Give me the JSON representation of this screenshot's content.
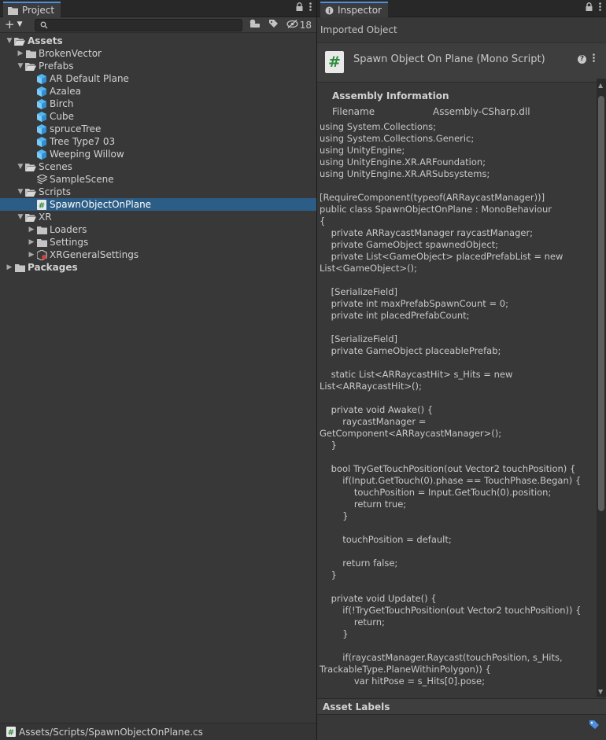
{
  "project": {
    "tab_label": "Project",
    "hidden_count": "18",
    "search_placeholder": "",
    "status_path": "Assets/Scripts/SpawnObjectOnPlane.cs",
    "tree": [
      {
        "label": "Assets",
        "depth": 0,
        "arrow": "down",
        "icon": "folder-open",
        "bold": true
      },
      {
        "label": "BrokenVector",
        "depth": 1,
        "arrow": "right",
        "icon": "folder"
      },
      {
        "label": "Prefabs",
        "depth": 1,
        "arrow": "down",
        "icon": "folder-open"
      },
      {
        "label": "AR Default Plane",
        "depth": 2,
        "arrow": "",
        "icon": "prefab"
      },
      {
        "label": "Azalea",
        "depth": 2,
        "arrow": "",
        "icon": "prefab"
      },
      {
        "label": "Birch",
        "depth": 2,
        "arrow": "",
        "icon": "prefab"
      },
      {
        "label": "Cube",
        "depth": 2,
        "arrow": "",
        "icon": "prefab"
      },
      {
        "label": "spruceTree",
        "depth": 2,
        "arrow": "",
        "icon": "prefab"
      },
      {
        "label": "Tree Type7 03",
        "depth": 2,
        "arrow": "",
        "icon": "prefab"
      },
      {
        "label": "Weeping Willow",
        "depth": 2,
        "arrow": "",
        "icon": "prefab"
      },
      {
        "label": "Scenes",
        "depth": 1,
        "arrow": "down",
        "icon": "folder-open"
      },
      {
        "label": "SampleScene",
        "depth": 2,
        "arrow": "",
        "icon": "scene"
      },
      {
        "label": "Scripts",
        "depth": 1,
        "arrow": "down",
        "icon": "folder-open"
      },
      {
        "label": "SpawnObjectOnPlane",
        "depth": 2,
        "arrow": "",
        "icon": "script",
        "selected": true
      },
      {
        "label": "XR",
        "depth": 1,
        "arrow": "down",
        "icon": "folder-open"
      },
      {
        "label": "Loaders",
        "depth": 2,
        "arrow": "right",
        "icon": "folder"
      },
      {
        "label": "Settings",
        "depth": 2,
        "arrow": "right",
        "icon": "folder"
      },
      {
        "label": "XRGeneralSettings",
        "depth": 2,
        "arrow": "right",
        "icon": "xr-settings"
      },
      {
        "label": "Packages",
        "depth": 0,
        "arrow": "right",
        "icon": "folder",
        "bold": true
      }
    ]
  },
  "inspector": {
    "tab_label": "Inspector",
    "header": "Imported Object",
    "asset_name": "Spawn Object On Plane (Mono Script)",
    "asset_icon_glyph": "#",
    "assembly_title": "Assembly Information",
    "filename_key": "Filename",
    "filename_value": "Assembly-CSharp.dll",
    "asset_labels": "Asset Labels",
    "code": "using System.Collections;\nusing System.Collections.Generic;\nusing UnityEngine;\nusing UnityEngine.XR.ARFoundation;\nusing UnityEngine.XR.ARSubsystems;\n\n[RequireComponent(typeof(ARRaycastManager))]\npublic class SpawnObjectOnPlane : MonoBehaviour\n{\n    private ARRaycastManager raycastManager;\n    private GameObject spawnedObject;\n    private List<GameObject> placedPrefabList = new\nList<GameObject>();\n\n    [SerializeField]\n    private int maxPrefabSpawnCount = 0;\n    private int placedPrefabCount;\n\n    [SerializeField]\n    private GameObject placeablePrefab;\n\n    static List<ARRaycastHit> s_Hits = new\nList<ARRaycastHit>();\n\n    private void Awake() {\n        raycastManager =\nGetComponent<ARRaycastManager>();\n    }\n\n    bool TryGetTouchPosition(out Vector2 touchPosition) {\n        if(Input.GetTouch(0).phase == TouchPhase.Began) {\n            touchPosition = Input.GetTouch(0).position;\n            return true;\n        }\n\n        touchPosition = default;\n\n        return false;\n    }\n\n    private void Update() {\n        if(!TryGetTouchPosition(out Vector2 touchPosition)) {\n            return;\n        }\n\n        if(raycastManager.Raycast(touchPosition, s_Hits,\nTrackableType.PlaneWithinPolygon)) {\n            var hitPose = s_Hits[0].pose;"
  },
  "colors": {
    "selection": "#2c5d87",
    "tab_accent": "#4a8fe0",
    "prefab_blue": "#52b6f0",
    "script_green": "#2b8c3b"
  }
}
